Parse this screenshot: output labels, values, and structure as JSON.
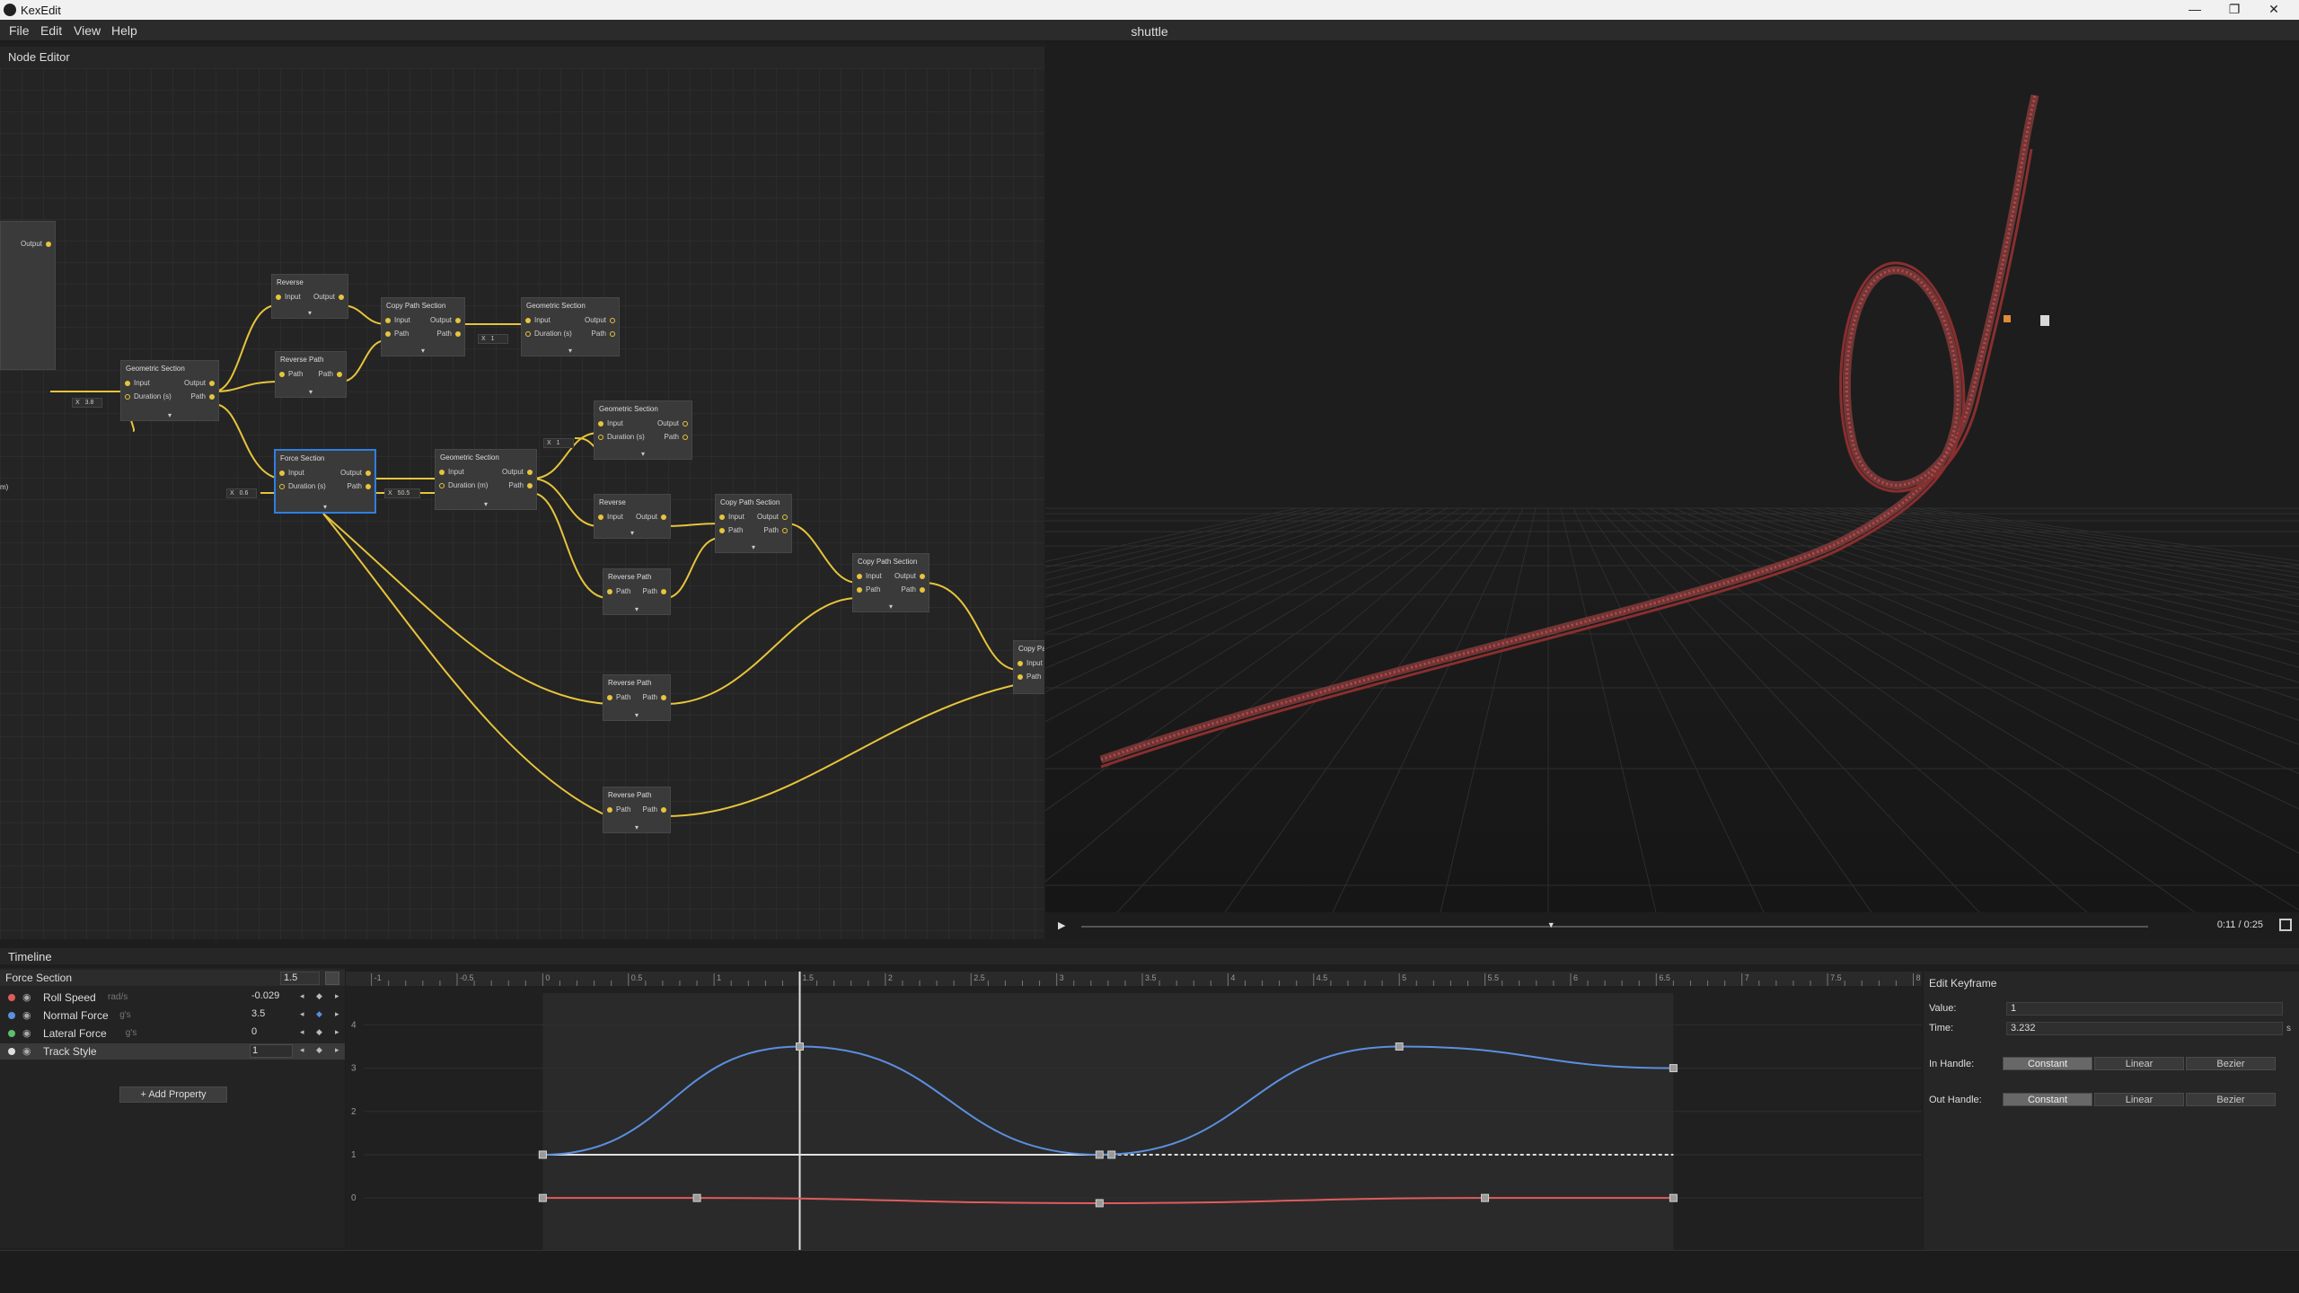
{
  "window": {
    "app_name": "KexEdit",
    "icons": {
      "app": "kexedit-logo-icon",
      "minimize": "minimize-icon",
      "maximize": "restore-icon",
      "close": "close-icon"
    },
    "minimize_glyph": "—",
    "maximize_glyph": "❐",
    "close_glyph": "✕"
  },
  "menu": {
    "items": [
      "File",
      "Edit",
      "View",
      "Help"
    ],
    "document_title": "shuttle"
  },
  "node_editor": {
    "title": "Node Editor",
    "wire_color": "#e7c43b",
    "selection_color": "#2f7fe0",
    "nodes": [
      {
        "title": "",
        "rows": [
          {
            "left": "",
            "right": "Output"
          }
        ]
      },
      {
        "title": "Geometric Section",
        "rows": [
          {
            "left": "Input",
            "right": "Output"
          },
          {
            "left": "Duration (s)",
            "right": "Path"
          }
        ]
      },
      {
        "title": "Reverse",
        "rows": [
          {
            "left": "Input",
            "right": "Output"
          }
        ]
      },
      {
        "title": "Reverse Path",
        "rows": [
          {
            "left": "Path",
            "right": "Path"
          }
        ]
      },
      {
        "title": "Copy Path Section",
        "rows": [
          {
            "left": "Input",
            "right": "Output"
          },
          {
            "left": "Path",
            "right": "Path"
          }
        ]
      },
      {
        "title": "Geometric Section",
        "rows": [
          {
            "left": "Input",
            "right": "Output"
          },
          {
            "left": "Duration (s)",
            "right": "Path"
          }
        ]
      },
      {
        "title": "Force Section",
        "rows": [
          {
            "left": "Input",
            "right": "Output"
          },
          {
            "left": "Duration (s)",
            "right": "Path"
          }
        ]
      },
      {
        "title": "Geometric Section",
        "rows": [
          {
            "left": "Input",
            "right": "Output"
          },
          {
            "left": "Duration (m)",
            "right": "Path"
          }
        ]
      },
      {
        "title": "Geometric Section",
        "rows": [
          {
            "left": "Input",
            "right": "Output"
          },
          {
            "left": "Duration (s)",
            "right": "Path"
          }
        ]
      },
      {
        "title": "Reverse",
        "rows": [
          {
            "left": "Input",
            "right": "Output"
          }
        ]
      },
      {
        "title": "Copy Path Section",
        "rows": [
          {
            "left": "Input",
            "right": "Output"
          },
          {
            "left": "Path",
            "right": "Path"
          }
        ]
      },
      {
        "title": "Reverse Path",
        "rows": [
          {
            "left": "Path",
            "right": "Path"
          }
        ]
      },
      {
        "title": "Copy Path Section",
        "rows": [
          {
            "left": "Input",
            "right": "Output"
          },
          {
            "left": "Path",
            "right": "Path"
          }
        ]
      },
      {
        "title": "Reverse Path",
        "rows": [
          {
            "left": "Path",
            "right": "Path"
          }
        ]
      },
      {
        "title": "Reverse Path",
        "rows": [
          {
            "left": "Path",
            "right": "Path"
          }
        ]
      },
      {
        "title": "Copy Pa",
        "rows": [
          {
            "left": "Input",
            "right": ""
          },
          {
            "left": "Path",
            "right": ""
          }
        ]
      }
    ],
    "params": [
      {
        "axis": "X",
        "value": "3.8"
      },
      {
        "axis": "X",
        "value": "1"
      },
      {
        "axis": "X",
        "value": "0.6"
      },
      {
        "axis": "X",
        "value": "50.5"
      },
      {
        "axis": "X",
        "value": "1"
      }
    ],
    "expand_glyph": "▾",
    "partial_label": "m)"
  },
  "viewport": {
    "track_color": "#b84a4a",
    "play_glyph": "▶",
    "scrub_glyph": "▼",
    "time_readout": "0:11 / 0:25",
    "scrub_fraction": 0.44,
    "icons": {
      "play": "play-icon",
      "fullscreen": "fullscreen-icon"
    }
  },
  "timeline": {
    "title": "Timeline",
    "section_name": "Force Section",
    "section_duration": "1.5",
    "add_property_label": "+ Add Property",
    "properties": [
      {
        "name": "Roll Speed",
        "unit": "rad/s",
        "value": "-0.029",
        "color": "#e05c5c",
        "visible": true,
        "keyed": false
      },
      {
        "name": "Normal Force",
        "unit": "g's",
        "value": "3.5",
        "color": "#5b8fe0",
        "visible": true,
        "keyed": true
      },
      {
        "name": "Lateral Force",
        "unit": "g's",
        "value": "0",
        "color": "#5bc06a",
        "visible": true,
        "keyed": false
      },
      {
        "name": "Track Style",
        "unit": "",
        "value": "1",
        "color": "#dddddd",
        "visible": true,
        "keyed": false
      }
    ],
    "icons": {
      "eye": "eye-icon",
      "prev_key": "prev-keyframe-icon",
      "key": "keyframe-diamond-icon",
      "next_key": "next-keyframe-icon",
      "graph": "graph-view-icon"
    },
    "glyphs": {
      "eye": "◉",
      "prev": "◂",
      "key": "◆",
      "next": "▸"
    },
    "ruler_labels": [
      "-1",
      "-0.5",
      "0",
      "0.5",
      "1",
      "1.5",
      "2",
      "2.5",
      "3",
      "3.5",
      "4",
      "4.5",
      "5",
      "5.5",
      "6",
      "6.5",
      "7",
      "7.5",
      "8"
    ],
    "y_labels": [
      "4",
      "3",
      "2",
      "1",
      "0"
    ],
    "playhead_time": 1.5,
    "curve_ranges": {
      "x": [
        -1.15,
        8.05
      ],
      "y": [
        -1.2,
        4.9
      ],
      "section": [
        0,
        6.6
      ]
    },
    "curves": {
      "normal_force": {
        "color": "#5b8fe0",
        "keys": [
          [
            0,
            1
          ],
          [
            1.5,
            3.5
          ],
          [
            3.25,
            1
          ],
          [
            5,
            3.5
          ],
          [
            6.6,
            3
          ]
        ]
      },
      "roll_speed": {
        "color": "#e05c5c",
        "keys": [
          [
            0,
            0
          ],
          [
            0.9,
            0
          ],
          [
            3.25,
            -0.12
          ],
          [
            5.5,
            0
          ],
          [
            6.6,
            0
          ]
        ]
      },
      "track_style": {
        "color": "#e0e0e0",
        "keys": [
          [
            0,
            1
          ],
          [
            3.32,
            1
          ]
        ],
        "dashed_to": 6.6
      }
    }
  },
  "keyframe_editor": {
    "title": "Edit Keyframe",
    "value_label": "Value:",
    "value": "1",
    "time_label": "Time:",
    "time": "3.232",
    "time_unit": "s",
    "in_handle_label": "In Handle:",
    "out_handle_label": "Out Handle:",
    "handle_options": [
      "Constant",
      "Linear",
      "Bezier"
    ],
    "in_handle_selected": "Constant",
    "out_handle_selected": "Constant"
  }
}
